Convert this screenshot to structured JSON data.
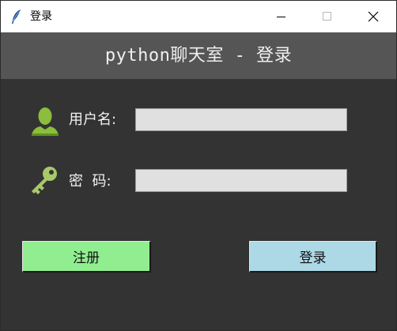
{
  "window": {
    "title": "登录",
    "controls": {
      "minimize": "minimize",
      "maximize": "maximize",
      "close": "close"
    }
  },
  "header": {
    "title": "python聊天室 - 登录"
  },
  "form": {
    "username_label": "用户名:",
    "password_label": "密  码:",
    "username_value": "",
    "password_value": ""
  },
  "buttons": {
    "register_label": "注册",
    "login_label": "登录"
  },
  "icons": {
    "app": "feather-icon",
    "user": "user-icon",
    "password": "key-icon"
  },
  "colors": {
    "background": "#333333",
    "header_band": "#555555",
    "register_button": "#90ee90",
    "login_button": "#add8e6",
    "input_background": "#e0e0e0",
    "icon_green": "#8bbe3c"
  }
}
